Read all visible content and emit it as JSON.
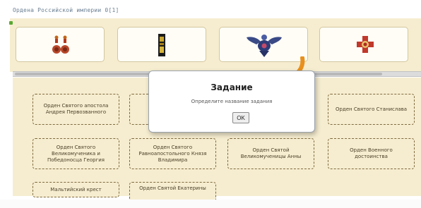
{
  "page": {
    "title": "Ордена Российской империи  0[1]"
  },
  "icons": [
    {
      "name": "earrings-medal-pair-icon"
    },
    {
      "name": "ribbon-bar-icon"
    },
    {
      "name": "eagle-order-icon"
    },
    {
      "name": "cross-order-icon"
    }
  ],
  "orders": [
    {
      "label": "Орден Святого апостола Андрея Первозванного"
    },
    {
      "label": "Ор"
    },
    {
      "label": ""
    },
    {
      "label": "Орден Святого Станислава"
    },
    {
      "label": "Орден Святого Великомученика и Победоносца Георгия"
    },
    {
      "label": "Орден Святого Равноапостольного Князя Владимира"
    },
    {
      "label": "Орден Святой Великомученицы Анны"
    },
    {
      "label": "Орден Военного достоинства"
    },
    {
      "label": "Мальтийский крест"
    },
    {
      "label": "Орден Святой Екатерины"
    }
  ],
  "dialog": {
    "title": "Задание",
    "text": "Определите название задания",
    "ok_label": "OK"
  },
  "colors": {
    "panel": "#f6edd0",
    "arrow": "#e8901e",
    "dashed_border": "#7e6a3e"
  }
}
